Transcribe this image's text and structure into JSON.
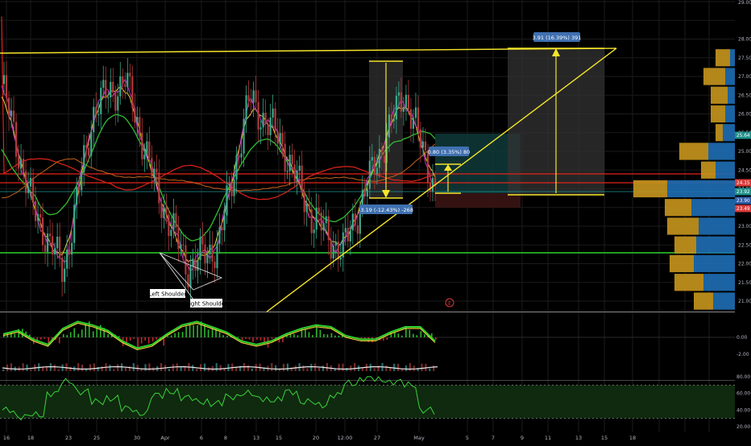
{
  "colors": {
    "background": "#000000",
    "grid": "#1b1b1b",
    "axis_text": "#b2b5be",
    "trendline_yellow": "#f5e52a",
    "support_green": "#2cd12c",
    "ma_red": "#e2231a",
    "ma_orange": "#c8621a",
    "ma_green": "#2fbf2f",
    "ema_yellow": "#e8d23a",
    "ema_magenta": "#d230c8",
    "price_cyan": "#1a9a9a",
    "volume_orange": "#c8961e",
    "volume_blue": "#1e6eb4",
    "rsi_fill": "#0f2a0f",
    "rsi_line": "#3bd23b",
    "badge_red": "#d93a3a",
    "badge_teal": "#1f8f8a",
    "badge_blue": "#2d5ca8",
    "label_blue": "#3f70b0"
  },
  "price_axis": {
    "labels": [
      "28.00",
      "27.50",
      "27.00",
      "26.50",
      "26.00",
      "25.50",
      "25.00",
      "24.50",
      "24.00",
      "23.50",
      "23.00",
      "22.50",
      "22.00",
      "21.50",
      "21.00"
    ],
    "top_label": "29.00",
    "badges": [
      {
        "text": "25.64",
        "color": "teal"
      },
      {
        "text": "24.15",
        "color": "red"
      },
      {
        "text": "23.92",
        "color": "teal"
      },
      {
        "text": "23.90",
        "color": "blue"
      },
      {
        "text": "23.49",
        "color": "red"
      }
    ]
  },
  "macd_axis": {
    "labels": [
      "0.00",
      "-2.00"
    ]
  },
  "rsi_axis": {
    "labels": [
      "80.00",
      "60.00",
      "40.00",
      "20.00"
    ]
  },
  "time_axis": {
    "labels": [
      "16",
      "18",
      "23",
      "25",
      "30",
      "Apr",
      "6",
      "8",
      "13",
      "15",
      "20",
      "12:00",
      "27",
      "May",
      "5",
      "7",
      "9",
      "11",
      "13",
      "15",
      "18"
    ]
  },
  "annotations": {
    "left_shoulder": "Left Shoulder",
    "right_shoulder": "Right Shoulder",
    "measure_down": "-3.19 (-12.43%) -268",
    "measure_small": "0.80 (3.35%) 80",
    "measure_target": "3.91 (16.39%) 391",
    "earnings_marker": "E"
  },
  "chart_data": {
    "type": "line",
    "title": "",
    "xlabel": "",
    "ylabel": "",
    "ylim": [
      20.75,
      29.0
    ],
    "x": [
      "Mar 16",
      "Mar 18",
      "Mar 23",
      "Mar 25",
      "Mar 30",
      "Apr 1",
      "Apr 6",
      "Apr 8",
      "Apr 13",
      "Apr 15",
      "Apr 20",
      "Apr 22",
      "Apr 27",
      "Apr 29",
      "May 1"
    ],
    "series": [
      {
        "values": [
          26.8,
          23.5,
          21.8,
          26.2,
          26.9,
          24.0,
          21.9,
          22.5,
          26.4,
          25.3,
          23.3,
          22.3,
          24.5,
          26.6,
          24.0
        ]
      }
    ],
    "levels": {
      "resistance_red": 24.15,
      "support_green": 22.25,
      "current": 23.92
    },
    "volume_profile": {
      "price_levels": [
        27.5,
        27.0,
        26.5,
        26.0,
        25.5,
        25.0,
        24.5,
        24.0,
        23.5,
        23.0,
        22.5,
        22.0,
        21.5,
        21.0
      ],
      "up_volume": [
        30,
        45,
        35,
        30,
        15,
        60,
        30,
        70,
        55,
        65,
        45,
        50,
        60,
        40
      ],
      "down_volume": [
        10,
        20,
        15,
        20,
        25,
        55,
        40,
        140,
        90,
        75,
        80,
        85,
        65,
        45
      ]
    },
    "rsi": {
      "ylim": [
        20,
        80
      ],
      "overbought": 70,
      "oversold": 30,
      "values": [
        40,
        32,
        34,
        60,
        74,
        62,
        50,
        54,
        42,
        36,
        58,
        62,
        55,
        50,
        48,
        56,
        60,
        54,
        52,
        62,
        50,
        46,
        58,
        72,
        78,
        76,
        74,
        70,
        40,
        38
      ]
    },
    "macd": {
      "ylim": [
        -2.5,
        1.2
      ],
      "histogram": [
        0.3,
        0.5,
        -0.4,
        -0.7,
        0.6,
        0.9,
        0.7,
        0.2,
        -0.5,
        -0.9,
        -0.6,
        0.3,
        0.8,
        0.9,
        0.6,
        0.1,
        -0.4,
        -0.6,
        -0.3,
        0.2,
        0.5,
        0.7,
        0.4,
        -0.1,
        -0.3,
        -0.2,
        0.3,
        0.6,
        0.5,
        -0.4
      ],
      "macd_line": [
        0.1,
        0.3,
        -0.2,
        -0.5,
        0.4,
        0.8,
        0.6,
        0.3,
        -0.3,
        -0.7,
        -0.5,
        0.1,
        0.6,
        0.8,
        0.5,
        0.2,
        -0.3,
        -0.5,
        -0.3,
        0.1,
        0.4,
        0.6,
        0.5,
        0.0,
        -0.2,
        -0.2,
        0.2,
        0.5,
        0.5,
        -0.3
      ]
    }
  }
}
